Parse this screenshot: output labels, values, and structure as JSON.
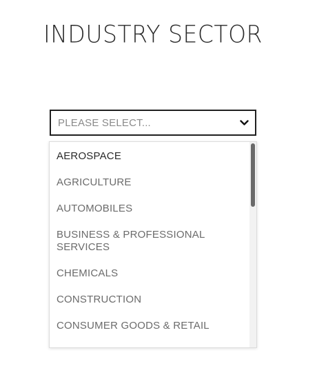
{
  "form": {
    "title": "INDUSTRY SECTOR",
    "select": {
      "placeholder": "PLEASE SELECT...",
      "icon": "chevron-down-icon"
    },
    "options": [
      "AEROSPACE",
      "AGRICULTURE",
      "AUTOMOBILES",
      "BUSINESS & PROFESSIONAL SERVICES",
      "CHEMICALS",
      "CONSTRUCTION",
      "CONSUMER GOODS & RETAIL"
    ],
    "highlighted_option": "AEROSPACE"
  },
  "colors": {
    "text_dark": "#2a2a2a",
    "text_muted": "#6b6b6b",
    "placeholder": "#8a8a8a",
    "border": "#1f1f1f",
    "scroll_thumb": "#6a6a6a"
  }
}
